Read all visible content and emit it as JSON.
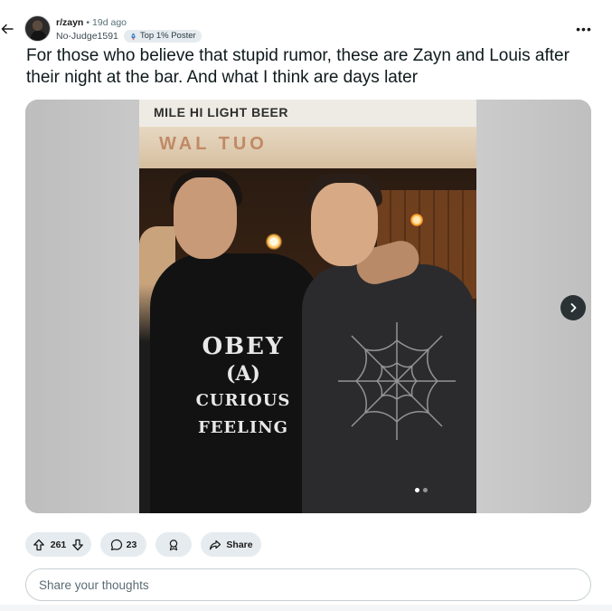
{
  "post": {
    "subreddit": "r/zayn",
    "separator": "•",
    "age": "19d ago",
    "author": "No-Judge1591",
    "flair": "Top 1% Poster",
    "more": "•••",
    "title": "For those who believe that stupid rumor, these are Zayn and Louis after their night at the bar. And what I think are days later"
  },
  "media": {
    "sign_text": "MILE HI LIGHT BEER",
    "awning_text": "WAL TUO",
    "shirt_line1": "OBEY",
    "shirt_line2": "(A)",
    "shirt_line3": "CURIOUS",
    "shirt_line4": "FEELING",
    "page_count": 2,
    "current_page": 1
  },
  "actions": {
    "upvotes": "261",
    "comments": "23",
    "share_label": "Share"
  },
  "comment_input": {
    "placeholder": "Share your thoughts"
  }
}
